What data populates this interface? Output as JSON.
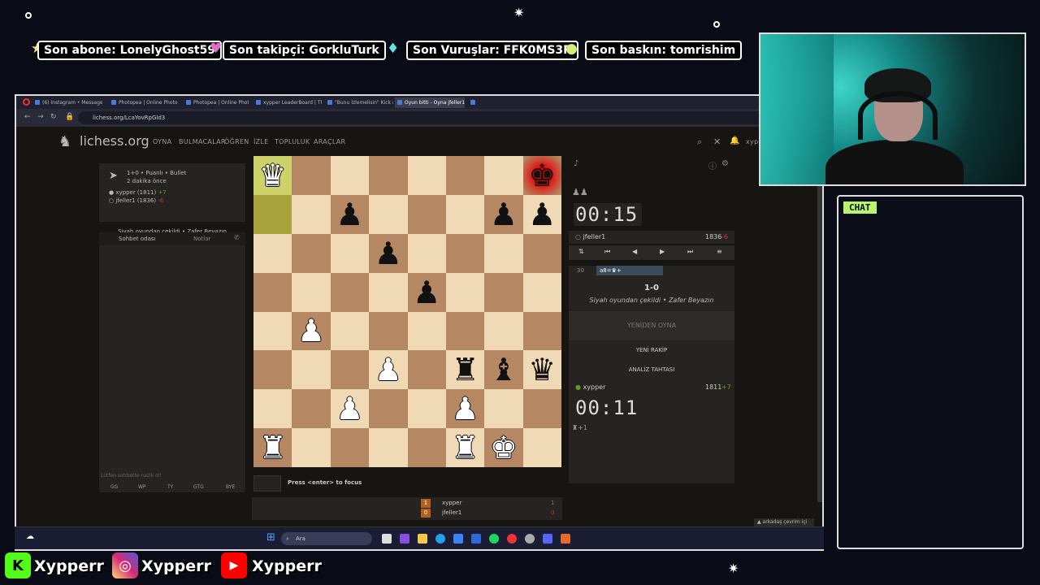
{
  "ticker": [
    {
      "label": "Son abone: LonelyGhost59"
    },
    {
      "label": "Son takipçi: GorkluTurk"
    },
    {
      "label": "Son Vuruşlar: FFK0MS3R"
    },
    {
      "label": "Son baskın: tomrishim"
    }
  ],
  "browser": {
    "tabs": [
      {
        "label": "(6) Instagram • Messages"
      },
      {
        "label": "Photopea | Online Photo"
      },
      {
        "label": "Photopea | Online Photo"
      },
      {
        "label": "xypper LeaderBoard | Th"
      },
      {
        "label": "\"Bunu İzlemelisin\" Kick &"
      },
      {
        "label": "Oyun bitti - Oyna jfeller1"
      }
    ],
    "new_tab": "+",
    "url": "lichess.org/LcaYovRpGld3"
  },
  "lichess": {
    "logo": "lichess.org",
    "nav": [
      "OYNA",
      "BULMACALAR",
      "ÖĞREN",
      "İZLE",
      "TOPLULUK",
      "ARAÇLAR"
    ],
    "user": "xypper",
    "game_info": {
      "mode": "1+0 • Puanlı • Bullet",
      "time_ago": "2 dakika önce",
      "white": "xypper (1811)",
      "white_diff": "+7",
      "black": "jfeller1 (1836)",
      "black_diff": "-6",
      "result_text": "Siyah oyundan çekildi • Zafer Beyazın"
    },
    "chat_tabs": {
      "room": "Sohbet odası",
      "notes": "Notlar"
    },
    "chat_placeholder": "Lütfen sohbette nazik ol!",
    "quick_chat": [
      "GG",
      "WP",
      "TY",
      "GTG",
      "BYE"
    ],
    "opponent": {
      "name": "jfeller1",
      "rating": "1836",
      "diff": "-6",
      "clock": "00:15"
    },
    "me": {
      "name": "xypper",
      "rating": "1811",
      "diff": "+7",
      "clock": "00:11"
    },
    "move_number": "30",
    "last_move": "a8=♛+",
    "result": "1-0",
    "result_text": "Siyah oyundan çekildi • Zafer Beyazın",
    "buttons": {
      "rematch": "YENİDEN OYNA",
      "new_opponent": "YENİ RAKİP",
      "analysis": "ANALİZ TAHTASI"
    },
    "material": "+1",
    "focus_hint": "Press <enter> to focus",
    "score_rows": [
      {
        "n": "1",
        "name": "xypper",
        "score": "1"
      },
      {
        "n": "0",
        "name": "jfeller1",
        "score": "0"
      }
    ],
    "friends": "arkadaş çevrim içi",
    "search_placeholder": "Ara"
  },
  "board": [
    [
      "wQ",
      "",
      "",
      "",
      "",
      "",
      "",
      "bK"
    ],
    [
      "",
      "",
      "bP",
      "",
      "",
      "",
      "bP",
      "bP"
    ],
    [
      "",
      "",
      "",
      "bP",
      "",
      "",
      "",
      ""
    ],
    [
      "",
      "",
      "",
      "",
      "bP",
      "",
      "",
      ""
    ],
    [
      "",
      "wP",
      "",
      "",
      "",
      "",
      "",
      ""
    ],
    [
      "",
      "",
      "",
      "wP",
      "",
      "bR",
      "bB",
      "bQ"
    ],
    [
      "",
      "",
      "wP",
      "",
      "",
      "wP",
      "",
      ""
    ],
    [
      "wR",
      "",
      "",
      "",
      "",
      "wR",
      "wK",
      ""
    ]
  ],
  "chat_label": "CHAT",
  "socials": [
    {
      "icon": "K",
      "name": "Xypperr",
      "color": "#53fc18"
    },
    {
      "icon": "◎",
      "name": "Xypperr",
      "color": "#d62976"
    },
    {
      "icon": "▶",
      "name": "Xypperr",
      "color": "#ff0000"
    }
  ]
}
